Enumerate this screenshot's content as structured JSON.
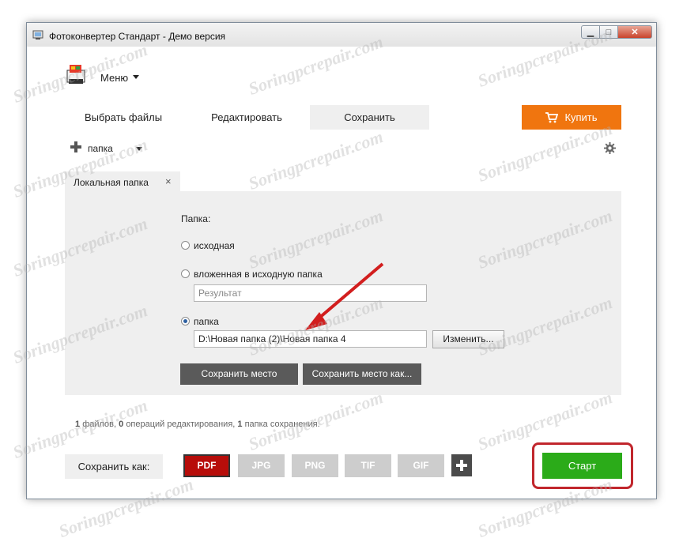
{
  "window": {
    "title": "Фотоконвертер Стандарт - Демо версия"
  },
  "menu": {
    "label": "Меню"
  },
  "tabs": [
    {
      "label": "Выбрать файлы",
      "active": false
    },
    {
      "label": "Редактировать",
      "active": false
    },
    {
      "label": "Сохранить",
      "active": true
    }
  ],
  "buy": {
    "label": "Купить",
    "color": "#f0750f"
  },
  "destination": {
    "label": "папка"
  },
  "panel": {
    "tab_label": "Локальная папка",
    "folder_label": "Папка:",
    "options": [
      {
        "label": "исходная",
        "selected": false
      },
      {
        "label": "вложенная в исходную папка",
        "selected": false
      },
      {
        "label": "папка",
        "selected": true
      }
    ],
    "subfolder_placeholder": "Результат",
    "folder_path": "D:\\Новая папка (2)\\Новая папка 4",
    "change_button": "Изменить...",
    "save_location_button": "Сохранить место",
    "save_location_as_button": "Сохранить место как..."
  },
  "status": {
    "files_count": "1",
    "files_text": "файлов,",
    "edit_count": "0",
    "edit_text": "операций редактирования,",
    "folder_count": "1",
    "folder_text": "папка сохранения."
  },
  "save_as": {
    "label": "Сохранить как:",
    "formats": [
      "PDF",
      "JPG",
      "PNG",
      "TIF",
      "GIF"
    ],
    "selected_format": "PDF",
    "selected_color": "#b70d0a"
  },
  "start": {
    "label": "Старт",
    "color": "#2bab19"
  },
  "watermark": "Soringpcrepair.com"
}
